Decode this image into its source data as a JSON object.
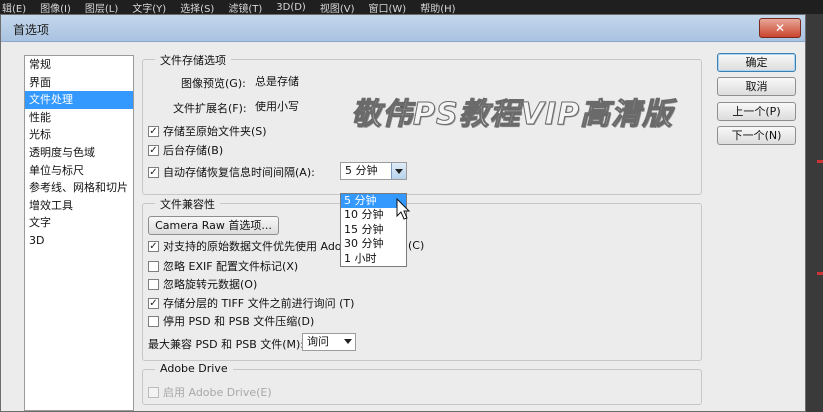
{
  "menubar": [
    "辑(E)",
    "图像(I)",
    "图层(L)",
    "文字(Y)",
    "选择(S)",
    "滤镜(T)",
    "3D(D)",
    "视图(V)",
    "窗口(W)",
    "帮助(H)"
  ],
  "dialog": {
    "title": "首选项",
    "close_glyph": "✕"
  },
  "watermark": "敬伟PS教程VIP高清版",
  "categories": [
    "常规",
    "界面",
    "文件处理",
    "性能",
    "光标",
    "透明度与色域",
    "单位与标尺",
    "参考线、网格和切片",
    "增效工具",
    "文字",
    "3D"
  ],
  "selected_category_index": 2,
  "file_save": {
    "legend": "文件存储选项",
    "preview_label": "图像预览(G):",
    "preview_value": "总是存储",
    "ext_label": "文件扩展名(F):",
    "ext_value": "使用小写",
    "save_original": {
      "label": "存储至原始文件夹(S)",
      "checked": true
    },
    "background_save": {
      "label": "后台存储(B)",
      "checked": true
    },
    "autosave": {
      "label": "自动存储恢复信息时间间隔(A):",
      "checked": true,
      "value": "5 分钟"
    },
    "autosave_options": [
      "5 分钟",
      "10 分钟",
      "15 分钟",
      "30 分钟",
      "1 小时"
    ],
    "autosave_selected_index": 0
  },
  "compat": {
    "legend": "文件兼容性",
    "camera_raw_button": "Camera Raw 首选项...",
    "prefer_raw_before": "对支持的原始数据文件优先使用 Adob",
    "prefer_raw_after": "(C)",
    "ignore_exif": "忽略 EXIF 配置文件标记(X)",
    "ignore_rotation": "忽略旋转元数据(O)",
    "ask_tiff": "存储分层的 TIFF 文件之前进行询问 (T)",
    "disable_psd": "停用 PSD 和 PSB 文件压缩(D)",
    "max_compat_label": "最大兼容 PSD 和 PSB 文件(M):",
    "max_compat_value": "询问",
    "checks": {
      "prefer_raw": true,
      "ignore_exif": false,
      "ignore_rotation": false,
      "ask_tiff": true,
      "disable_psd": false
    }
  },
  "adobe_drive": {
    "legend": "Adobe Drive",
    "enable_label": "启用 Adobe Drive(E)",
    "checked": false
  },
  "buttons": {
    "ok": "确定",
    "cancel": "取消",
    "prev": "上一个(P)",
    "next": "下一个(N)"
  },
  "check_glyph": "✓"
}
